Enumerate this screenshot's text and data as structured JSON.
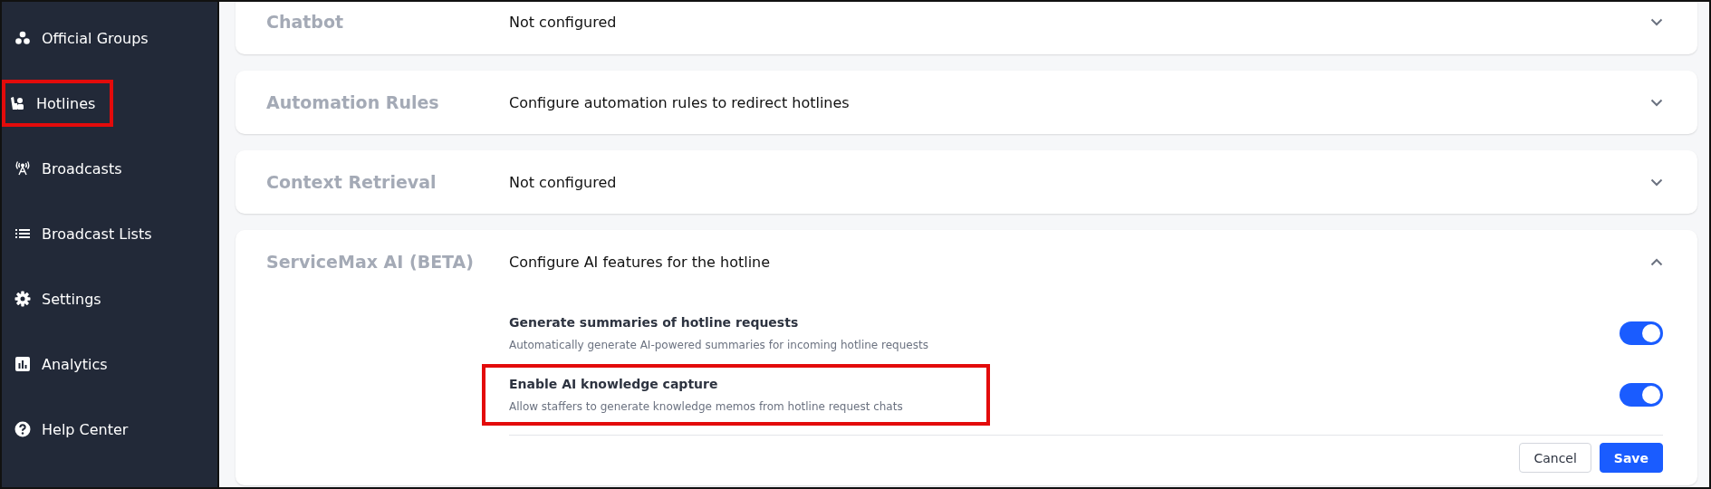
{
  "sidebar": {
    "items": [
      {
        "label": "Official Groups",
        "highlighted": false
      },
      {
        "label": "Hotlines",
        "highlighted": true
      },
      {
        "label": "Broadcasts",
        "highlighted": false
      },
      {
        "label": "Broadcast Lists",
        "highlighted": false
      },
      {
        "label": "Settings",
        "highlighted": false
      },
      {
        "label": "Analytics",
        "highlighted": false
      },
      {
        "label": "Help Center",
        "highlighted": false
      }
    ]
  },
  "sections": [
    {
      "title": "Chatbot",
      "summary": "Not configured",
      "expanded": false
    },
    {
      "title": "Automation Rules",
      "summary": "Configure automation rules to redirect hotlines",
      "expanded": false
    },
    {
      "title": "Context Retrieval",
      "summary": "Not configured",
      "expanded": false
    },
    {
      "title": "ServiceMax AI (BETA)",
      "summary": "Configure AI features for the hotline",
      "expanded": true,
      "settings": [
        {
          "label": "Generate summaries of hotline requests",
          "description": "Automatically generate AI-powered summaries for incoming hotline requests",
          "on": true,
          "highlighted": false
        },
        {
          "label": "Enable AI knowledge capture",
          "description": "Allow staffers to generate knowledge memos from hotline request chats",
          "on": true,
          "highlighted": true
        }
      ],
      "buttons": [
        {
          "label": "Cancel",
          "kind": "secondary"
        },
        {
          "label": "Save",
          "kind": "primary"
        }
      ]
    }
  ]
}
